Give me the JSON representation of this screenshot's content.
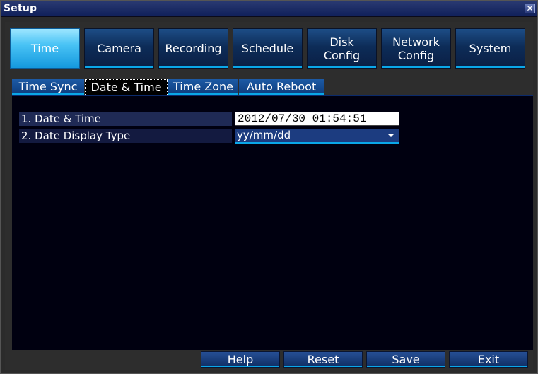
{
  "window": {
    "title": "Setup",
    "close_label": "✕"
  },
  "main_tabs": [
    {
      "label": "Time",
      "label2": ""
    },
    {
      "label": "Camera",
      "label2": ""
    },
    {
      "label": "Recording",
      "label2": ""
    },
    {
      "label": "Schedule",
      "label2": ""
    },
    {
      "label": "Disk",
      "label2": "Config"
    },
    {
      "label": "Network",
      "label2": "Config"
    },
    {
      "label": "System",
      "label2": ""
    }
  ],
  "active_main_tab": "Time",
  "sub_tabs": [
    "Time Sync",
    "Date & Time",
    "Time Zone",
    "Auto Reboot"
  ],
  "active_sub_tab": "Date & Time",
  "settings": {
    "date_time_label": "1. Date & Time",
    "date_time_value": "2012/07/30  01:54:51",
    "display_type_label": "2. Date Display Type",
    "display_type_value": "yy/mm/dd"
  },
  "buttons": {
    "help": "Help",
    "reset": "Reset",
    "save": "Save",
    "exit": "Exit"
  },
  "colors": {
    "accent": "#0aa7e8",
    "active_tab": "#49c3f5",
    "tab_bg": "#0d2c58",
    "content_bg": "#000010"
  }
}
